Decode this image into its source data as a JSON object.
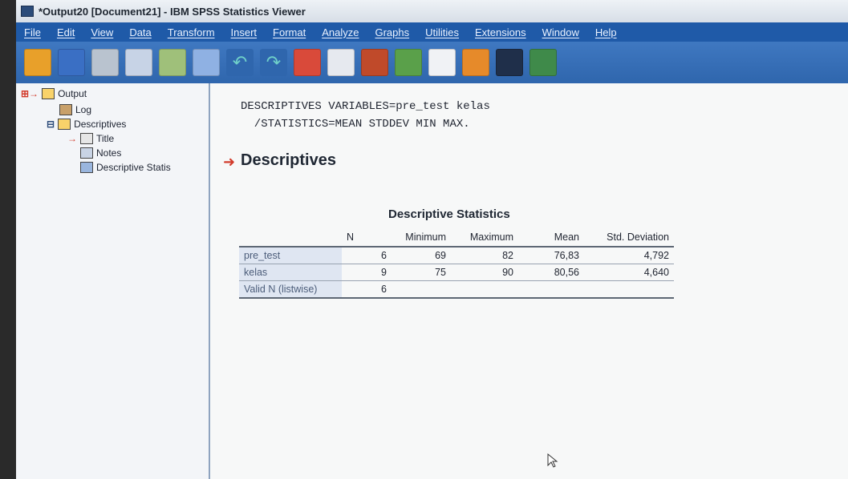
{
  "window": {
    "title": "*Output20 [Document21] - IBM SPSS Statistics Viewer"
  },
  "menu": [
    "File",
    "Edit",
    "View",
    "Data",
    "Transform",
    "Insert",
    "Format",
    "Analyze",
    "Graphs",
    "Utilities",
    "Extensions",
    "Window",
    "Help"
  ],
  "toolbar": {
    "icons": [
      "open-icon",
      "save-icon",
      "print-icon",
      "print-preview-icon",
      "export-icon",
      "recall-dialog-icon",
      "undo-icon",
      "redo-icon",
      "goto-data-icon",
      "goto-variable-icon",
      "insert-table-icon",
      "variables-icon",
      "designate-window-icon",
      "run-icon",
      "script-icon",
      "toggle-icon"
    ]
  },
  "outline": {
    "output": "Output",
    "log": "Log",
    "descriptives": "Descriptives",
    "title": "Title",
    "notes": "Notes",
    "descriptive_stats": "Descriptive Statis"
  },
  "syntax": {
    "line1": "DESCRIPTIVES VARIABLES=pre_test kelas",
    "line2": "  /STATISTICS=MEAN STDDEV MIN MAX."
  },
  "section": {
    "title": "Descriptives"
  },
  "table": {
    "title": "Descriptive Statistics",
    "headers": [
      "",
      "N",
      "Minimum",
      "Maximum",
      "Mean",
      "Std. Deviation"
    ],
    "rows": [
      {
        "label": "pre_test",
        "n": "6",
        "min": "69",
        "max": "82",
        "mean": "76,83",
        "sd": "4,792"
      },
      {
        "label": "kelas",
        "n": "9",
        "min": "75",
        "max": "90",
        "mean": "80,56",
        "sd": "4,640"
      },
      {
        "label": "Valid N (listwise)",
        "n": "6",
        "min": "",
        "max": "",
        "mean": "",
        "sd": ""
      }
    ]
  }
}
